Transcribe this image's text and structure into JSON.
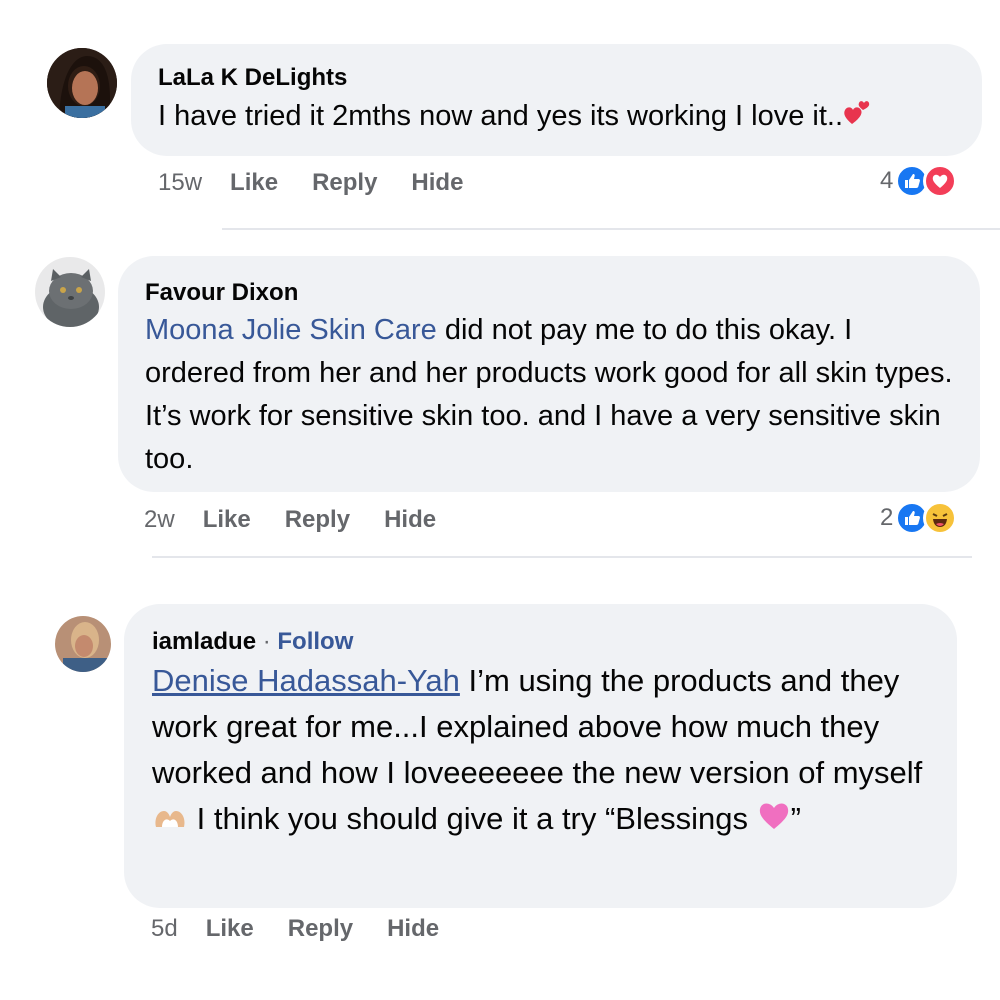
{
  "comments": [
    {
      "author": "LaLa K DeLights",
      "text": "I have tried it 2mths now and yes its working I love it..",
      "emoji": "two-hearts-icon",
      "time": "15w",
      "actions": [
        "Like",
        "Reply",
        "Hide"
      ],
      "reaction_count": "4",
      "reactions": [
        "like-icon",
        "love-icon"
      ]
    },
    {
      "author": "Favour Dixon",
      "mention": "Moona Jolie Skin Care",
      "text": " did not pay me to do this okay. I ordered from her and her products work good for all skin types. It’s work for sensitive skin too. and I have a very sensitive skin too.",
      "time": "2w",
      "actions": [
        "Like",
        "Reply",
        "Hide"
      ],
      "reaction_count": "2",
      "reactions": [
        "like-icon",
        "haha-icon"
      ]
    },
    {
      "author": "iamladue",
      "separator": "·",
      "follow": "Follow",
      "mention": "Denise Hadassah-Yah",
      "text_part1": " I’m using the products and they work great for me...I explained above how much they worked and how I loveeeeeee the new version of myself ",
      "text_part2": " I think you should give it a try “Blessings ",
      "text_part3": "”",
      "time": "5d",
      "actions": [
        "Like",
        "Reply",
        "Hide"
      ]
    }
  ],
  "colors": {
    "bubble": "#f0f2f5",
    "link": "#385898",
    "meta": "#65676b",
    "like": "#1877f2",
    "love": "#f33e58"
  }
}
